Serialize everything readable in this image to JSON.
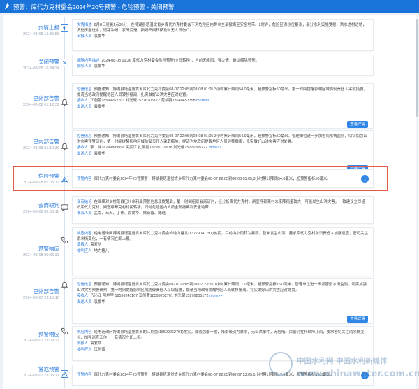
{
  "header": {
    "title": "预警：库代力克村委会2024年20号预警 - 危险预警 - 关闭预警"
  },
  "events": [
    {
      "title": "灾情上报",
      "time": "2024-08-08 16:35:58",
      "icon": "upload-icon",
      "rows": [
        {
          "label": "灾情描述",
          "text": "8月8日凌晨1点30分，在博湖县塔温觉肯乡库代力克村委会下河危险区内群众全部撤离至安全地带。2时许，危险区洪水位暴涨，部分水利设施受损，洪水进村进地，多处房屋进水，道路冲毁，农田受淹，损毁田间转移及时无人员伤亡。"
        },
        {
          "label": "上报人员",
          "text": "袁爱华"
        }
      ]
    },
    {
      "title": "关闭预警",
      "time": "2024-08-08 16:34:34",
      "icon": "close-icon",
      "rows": [
        {
          "label": "解除内容描述",
          "text": "2024-08-08 16:36 库代力克村委会危险预警(立即转移)，当前无降雨，有灾情，确认解除预警。"
        },
        {
          "label": "解除人员",
          "text": "袁爱华"
        }
      ]
    },
    {
      "title": "已外部告警",
      "time": "2024-08-08 01:12:32",
      "icon": "bell-icon",
      "rows": [
        {
          "label": "短信信息",
          "text": "预警通知：博湖县塔温觉肯乡库代力克村委会08-07 22:05到08-08 01:05,3小时累计降雨54.0毫米，超预警指标50毫米。第一时间提醒影响区域防御责任人采取措施，提请当地政府提醒地区人员转移撤离，扎实做好山洪灾害应对处置。"
        },
        {
          "label": "接收人",
          "text": "江创蕾18599262701 刘光耀15276205172 范加腾13640453758 more>>"
        },
        {
          "label": "发送人员",
          "text": "袁爱华"
        }
      ],
      "button": "查看详情"
    },
    {
      "title": "已内部告警",
      "time": "2024-08-08 01:10:39",
      "icon": "bell-icon",
      "rows": [
        {
          "label": "短信信息",
          "text": "预警通知：博湖县塔温觉肯乡库代力克村委会08-07 22:05到08-08 01:05,3小时累计降雨54.0毫米，超预警指标50毫米。管理单位进一步加密雨水情监测，切实加强山洪灾害预警研判，第一时间提醒影响区域防御责任人采取措施，提请当地政府提醒地区人员转移撤离，扎实做好山洪灾害应对处置。"
        },
        {
          "label": "接收人",
          "text": "李　伟18299889998 买买江 扎伊提18299779978 刘光耀15276205172 more>>"
        },
        {
          "label": "发送人员",
          "text": "袁爱华"
        }
      ],
      "button": "查看详情"
    },
    {
      "title": "危险预警",
      "time": "2024-08-08 01:05:17",
      "icon": "warning-icon",
      "rows": [
        {
          "label": "预警内容",
          "text": "库代力克村委会2024年20号预警：博湖县塔温觉肯乡库代力克村委会08-07 22:05到08-08 01:05,3小时累计降雨54.0毫米，超预警指标50毫米。"
        }
      ]
    },
    {
      "title": "会商研判",
      "time": "2024-08-08 00:56:18",
      "icon": "chat-icon",
      "rows": [
        {
          "label": "会商结论",
          "text": "在继续对乡村范目巴州水利局预警信息及提醒后，第一时间组织会商研判，经分析库代力克村，闸壹呼都克村未来降雨量较大，可能发生山洪灾害，一致建议立即组织库代力克村、闸壹呼都克村村民转移，同时危险区内人员全部撤离到安全地带。"
        },
        {
          "label": "参会人员",
          "text": "孟南、马天、丁伟、袁爱华、陈新霞、陈瑶"
        }
      ]
    },
    {
      "title": "预警响应",
      "time": "2024-08-08 00:36:33",
      "icon": "phone-icon",
      "rows": [
        {
          "label": "响应内容",
          "text": "经电话询问博湖县塔温觉肯乡库代力克村委会的地力格儿(13779041791)核实，目前由小雨转为暴雨，暂未发生山洪，要求库代力克村防汛责任人加强巡查，密切关注雨水情变化，一有情况立即上报。"
        },
        {
          "label": "填报人",
          "text": "袁爱华"
        },
        {
          "label": "被响应人",
          "text": "地力格儿"
        }
      ]
    },
    {
      "title": "已外部告警",
      "time": "2024-08-07 23:15:18",
      "icon": "bell-icon",
      "rows": [
        {
          "label": "短信信息",
          "text": "预警通知：博湖县塔温觉肯乡库代力克村委会08-07 22:05到08-07 23:05,1小时累计降雨17.0毫米，超预警指标15.0毫米。管理单位进一步加密雨水情监测，切实加强山洪灾害预警研判，第一时间提醒影响区域防御责任人采取措施，提请当地政府提醒地区人员转移撤离，扎实做好山洪灾害应对处置。"
        },
        {
          "label": "接收人",
          "text": "乃沁江 阿地里 18599241167 江创蕾18599262701 刘光耀15276205172 more>>"
        },
        {
          "label": "发送人员",
          "text": "袁爱华"
        }
      ],
      "button": "查看详情"
    },
    {
      "title": "预警响应",
      "time": "2024-08-07 23:09:27",
      "icon": "phone-icon",
      "rows": [
        {
          "label": "响应内容",
          "text": "经电话询问博湖县塔温觉肯乡的江创蕾(18599262701)核实，降雨强度一般，降雨级别为暴雨，无山洪事件，无险情。目前仍在持续降小雨，要求密切关注雨水情变化，加强巡查工作，一有情况立即上报。"
        },
        {
          "label": "填报人",
          "text": "袁爱华"
        },
        {
          "label": "被响应人",
          "text": "江创蕾"
        }
      ]
    },
    {
      "title": "警戒预警",
      "time": "2024-08-07 23:05:17",
      "icon": "warning-icon",
      "rows": [
        {
          "label": "预警内容",
          "text": "库代力克村委会2024年20号预警：博湖县塔温觉肯乡库代力克村委会08-07 22:05到08-07 23:05,1小时累计降雨17.0毫米，超预警指标15.0毫米。"
        }
      ]
    }
  ],
  "watermark": {
    "cn": "中国水利网 中国水利新媒体",
    "url": "www.chinawater.com.cn"
  },
  "colors": {
    "accent": "#2f86e6",
    "highlight": "#e35b4a"
  }
}
